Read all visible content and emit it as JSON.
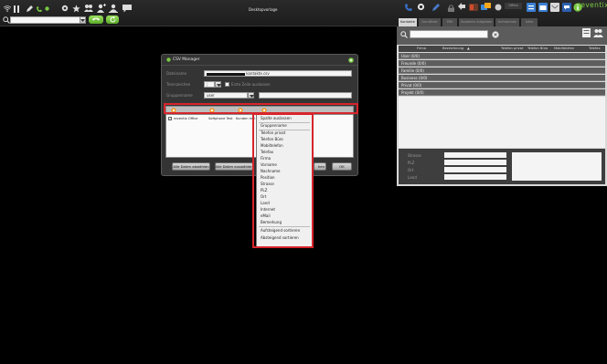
{
  "app": {
    "title": "Desktopvorlage",
    "brand": "reventix",
    "office_label": "Office",
    "accent": "#7ac943",
    "highlight_color": "#d7242b"
  },
  "toolbar": {
    "left_icons": [
      "wifi-icon",
      "grid-icon",
      "pencil-icon",
      "phone-icon",
      "circle-icon",
      "search-icon",
      "star-icon",
      "people-icon",
      "person-add-icon",
      "scan-icon",
      "chat-icon"
    ],
    "search_value": "",
    "dropdown_value": ""
  },
  "right_panel": {
    "tabs": [
      "Kontakte",
      "Anrufliste",
      "PIM",
      "Geplante Aufgaben",
      "Aufnahmen",
      "Infos"
    ],
    "columns": [
      "Firma",
      "Bezeichnung",
      "Telefon privat",
      "Telefon Büro",
      "Mobiltelefon",
      "Telefax"
    ],
    "categories": [
      "User (0/0)",
      "Freunde (0/0)",
      "Familie (0/0)",
      "Business (0/0)",
      "Privat (0/0)",
      "Projekt (0/0)"
    ],
    "detail_labels": [
      "Strasse",
      "PLZ",
      "Ort",
      "Land"
    ]
  },
  "csv_manager": {
    "title": "CSV Manager",
    "fields": {
      "datei_label": "Dateiname",
      "datei_value": "kontakte.csv",
      "trenn_label": "Trennzeichen",
      "trenn_value": ";",
      "checkbox_label": "Erste Zeile auslassen",
      "gruppe_label": "Gruppenname",
      "gruppe_value": "user"
    },
    "columns": [
      "reventix Office",
      "Softphone Test",
      "Kunden mai"
    ],
    "buttons": {
      "select_all": "Alle Daten abwählen",
      "select_all2": "Alle Daten auswählen",
      "import": "hen",
      "ok": "OK"
    }
  },
  "context_menu": {
    "items": [
      "Spalte auslassen",
      "Gruppenname",
      "Telefon privat",
      "Telefon Büro",
      "Mobiltelefon",
      "Telefax",
      "Firma",
      "Vorname",
      "Nachname",
      "Position",
      "Strasse",
      "PLZ",
      "Ort",
      "Land",
      "Internet",
      "eMail",
      "Bemerkung",
      "Aufsteigend sortieren",
      "Absteigend sortieren"
    ]
  }
}
